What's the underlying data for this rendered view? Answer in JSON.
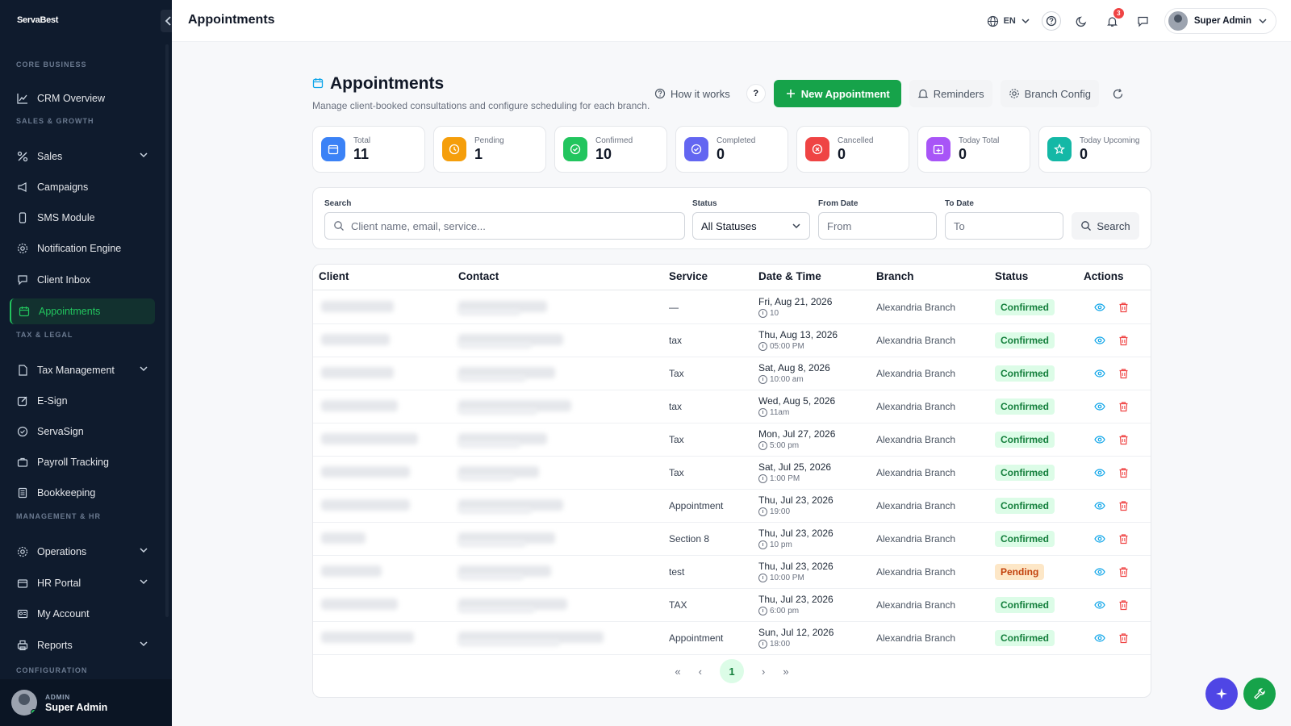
{
  "app": {
    "logo_text": "ServaBest",
    "page_title": "Appointments"
  },
  "sidebar": {
    "sections": {
      "core_business": "CORE BUSINESS",
      "sales_growth": "SALES & GROWTH",
      "tax_legal": "TAX & LEGAL",
      "management_hr": "MANAGEMENT & HR",
      "configuration": "CONFIGURATION"
    },
    "items": [
      {
        "label": "CRM Overview",
        "icon": "chart-line-icon"
      },
      {
        "label": "Sales",
        "icon": "percent-icon"
      },
      {
        "label": "Campaigns",
        "icon": "megaphone-icon"
      },
      {
        "label": "SMS Module",
        "icon": "phone-icon"
      },
      {
        "label": "Notification Engine",
        "icon": "gear-icon"
      },
      {
        "label": "Client Inbox",
        "icon": "chat-icon"
      },
      {
        "label": "Appointments",
        "icon": "calendar-icon"
      },
      {
        "label": "Tax Management",
        "icon": "document-icon"
      },
      {
        "label": "E-Sign",
        "icon": "pen-square-icon"
      },
      {
        "label": "ServaSign",
        "icon": "check-circle-icon"
      },
      {
        "label": "Payroll Tracking",
        "icon": "briefcase-icon"
      },
      {
        "label": "Bookkeeping",
        "icon": "book-icon"
      },
      {
        "label": "Operations",
        "icon": "cog-icon"
      },
      {
        "label": "HR Portal",
        "icon": "id-card-icon"
      },
      {
        "label": "My Account",
        "icon": "account-card-icon"
      },
      {
        "label": "Reports",
        "icon": "printer-icon"
      }
    ],
    "user": {
      "role": "ADMIN",
      "name": "Super Admin"
    }
  },
  "topbar": {
    "language": "EN",
    "notification_count": "3",
    "profile_name": "Super Admin"
  },
  "header": {
    "title": "Appointments",
    "subtitle": "Manage client-booked consultations and configure scheduling for each branch.",
    "how_it_works": "How it works",
    "help": "?",
    "new_appointment": "New Appointment",
    "reminders": "Reminders",
    "branch_config": "Branch Config"
  },
  "stats": [
    {
      "label": "Total",
      "value": "11",
      "color": "#3b82f6",
      "icon": "calendar-icon"
    },
    {
      "label": "Pending",
      "value": "1",
      "color": "#f59e0b",
      "icon": "clock-icon"
    },
    {
      "label": "Confirmed",
      "value": "10",
      "color": "#22c55e",
      "icon": "check-circle-icon"
    },
    {
      "label": "Completed",
      "value": "0",
      "color": "#6366f1",
      "icon": "check-badge-icon"
    },
    {
      "label": "Cancelled",
      "value": "0",
      "color": "#ef4444",
      "icon": "x-circle-icon"
    },
    {
      "label": "Today Total",
      "value": "0",
      "color": "#a855f7",
      "icon": "calendar-plus-icon"
    },
    {
      "label": "Today Upcoming",
      "value": "0",
      "color": "#14b8a6",
      "icon": "star-icon"
    }
  ],
  "filters": {
    "search_label": "Search",
    "search_placeholder": "Client name, email, service...",
    "status_label": "Status",
    "status_value": "All Statuses",
    "from_label": "From Date",
    "from_placeholder": "From",
    "to_label": "To Date",
    "to_placeholder": "To",
    "search_button": "Search"
  },
  "table": {
    "columns": [
      "Client",
      "Contact",
      "Service",
      "Date & Time",
      "Branch",
      "Status",
      "Actions"
    ],
    "rows": [
      {
        "service": "—",
        "date": "Fri, Aug 21, 2026",
        "time": "10",
        "branch": "Alexandria Branch",
        "status": "Confirmed"
      },
      {
        "service": "tax",
        "date": "Thu, Aug 13, 2026",
        "time": "05:00 PM",
        "branch": "Alexandria Branch",
        "status": "Confirmed"
      },
      {
        "service": "Tax",
        "date": "Sat, Aug 8, 2026",
        "time": "10:00 am",
        "branch": "Alexandria Branch",
        "status": "Confirmed"
      },
      {
        "service": "tax",
        "date": "Wed, Aug 5, 2026",
        "time": "11am",
        "branch": "Alexandria Branch",
        "status": "Confirmed"
      },
      {
        "service": "Tax",
        "date": "Mon, Jul 27, 2026",
        "time": "5:00 pm",
        "branch": "Alexandria Branch",
        "status": "Confirmed"
      },
      {
        "service": "Tax",
        "date": "Sat, Jul 25, 2026",
        "time": "1:00 PM",
        "branch": "Alexandria Branch",
        "status": "Confirmed"
      },
      {
        "service": "Appointment",
        "date": "Thu, Jul 23, 2026",
        "time": "19:00",
        "branch": "Alexandria Branch",
        "status": "Confirmed"
      },
      {
        "service": "Section 8",
        "date": "Thu, Jul 23, 2026",
        "time": "10 pm",
        "branch": "Alexandria Branch",
        "status": "Confirmed"
      },
      {
        "service": "test",
        "date": "Thu, Jul 23, 2026",
        "time": "10:00 PM",
        "branch": "Alexandria Branch",
        "status": "Pending"
      },
      {
        "service": "TAX",
        "date": "Thu, Jul 23, 2026",
        "time": "6:00 pm",
        "branch": "Alexandria Branch",
        "status": "Confirmed"
      },
      {
        "service": "Appointment",
        "date": "Sun, Jul 12, 2026",
        "time": "18:00",
        "branch": "Alexandria Branch",
        "status": "Confirmed"
      }
    ]
  },
  "pagination": {
    "first": "«",
    "prev": "‹",
    "current": "1",
    "next": "›",
    "last": "»"
  },
  "colors": {
    "accent": "#16a34a",
    "sidebar_bg": "#0f1b2d",
    "confirmed": "#15803d",
    "pending": "#c2410c",
    "fab_ai": "#4f46e5",
    "fab_tools": "#16a34a"
  }
}
